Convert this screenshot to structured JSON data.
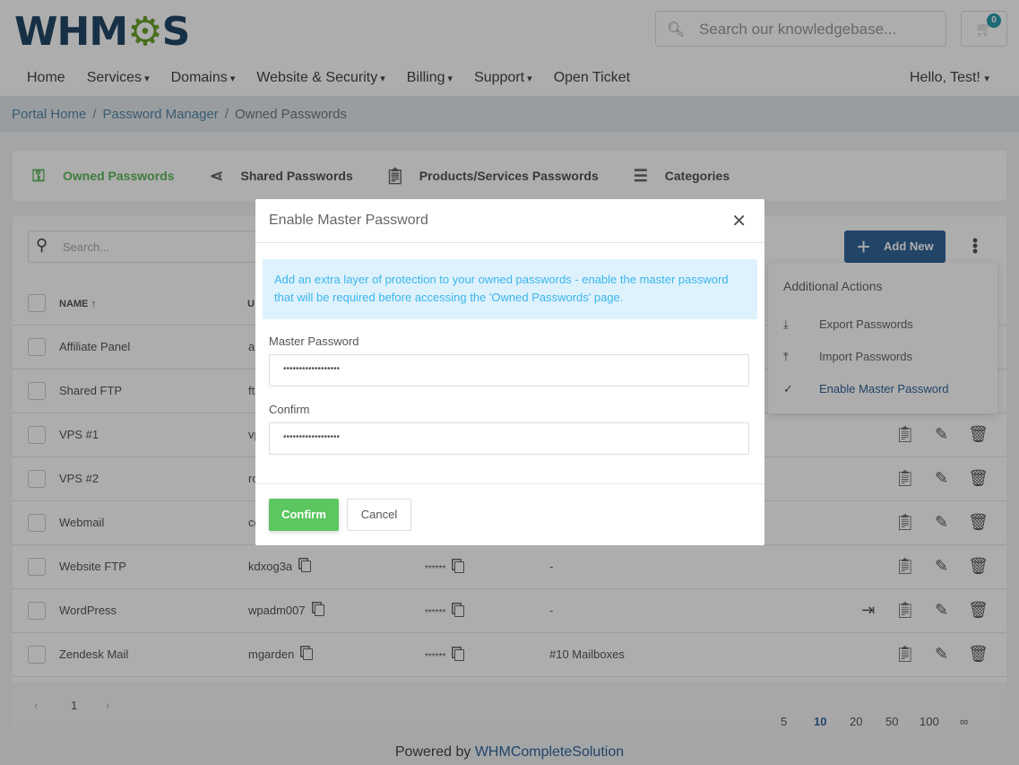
{
  "header": {
    "logo": "WHMCS",
    "search_placeholder": "Search our knowledgebase...",
    "cart_count": "0",
    "nav": [
      {
        "label": "Home",
        "dropdown": false
      },
      {
        "label": "Services",
        "dropdown": true
      },
      {
        "label": "Domains",
        "dropdown": true
      },
      {
        "label": "Website & Security",
        "dropdown": true
      },
      {
        "label": "Billing",
        "dropdown": true
      },
      {
        "label": "Support",
        "dropdown": true
      },
      {
        "label": "Open Ticket",
        "dropdown": false
      }
    ],
    "user_menu": "Hello, Test!"
  },
  "breadcrumb": [
    "Portal Home",
    "Password Manager",
    "Owned Passwords"
  ],
  "tabs": [
    {
      "label": "Owned Passwords",
      "icon": "key-icon",
      "active": true
    },
    {
      "label": "Shared Passwords",
      "icon": "share-icon"
    },
    {
      "label": "Products/Services Passwords",
      "icon": "clipboard-icon"
    },
    {
      "label": "Categories",
      "icon": "list-icon"
    }
  ],
  "table": {
    "search_placeholder": "Search...",
    "add_new": "Add New",
    "headers": {
      "name": "NAME ↑",
      "username": "U"
    },
    "rows": [
      {
        "name": "Affiliate Panel",
        "username": "a",
        "password": "",
        "note": "",
        "login": false
      },
      {
        "name": "Shared FTP",
        "username": "ft",
        "password": "",
        "note": "",
        "login": false
      },
      {
        "name": "VPS #1",
        "username": "vp",
        "password": "",
        "note": "",
        "login": false
      },
      {
        "name": "VPS #2",
        "username": "ro",
        "password": "",
        "note": "",
        "login": false
      },
      {
        "name": "Webmail",
        "username": "co",
        "password": "",
        "note": "",
        "login": false
      },
      {
        "name": "Website FTP",
        "username": "kdxog3a",
        "password": "******",
        "note": "-",
        "login": false
      },
      {
        "name": "WordPress",
        "username": "wpadm007",
        "password": "******",
        "note": "-",
        "login": true
      },
      {
        "name": "Zendesk Mail",
        "username": "mgarden",
        "password": "******",
        "note": "#10 Mailboxes",
        "login": false
      }
    ],
    "pagination": {
      "current": "1",
      "page_sizes": [
        "5",
        "10",
        "20",
        "50",
        "100",
        "∞"
      ],
      "selected_size": "10"
    }
  },
  "dropdown": {
    "title": "Additional Actions",
    "items": [
      {
        "label": "Export Passwords",
        "icon": "download-icon"
      },
      {
        "label": "Import Passwords",
        "icon": "upload-icon"
      },
      {
        "label": "Enable Master Password",
        "icon": "check-icon"
      }
    ]
  },
  "footer": {
    "prefix": "Powered by",
    "link": "WHMCompleteSolution"
  },
  "modal": {
    "title": "Enable Master Password",
    "info": "Add an extra layer of protection to your owned passwords - enable the master password that will be required before accessing the 'Owned Passwords' page.",
    "master_label": "Master Password",
    "master_value": "••••••••••••••••••",
    "confirm_label": "Confirm",
    "confirm_value": "••••••••••••••••••",
    "confirm_button": "Confirm",
    "cancel_button": "Cancel"
  },
  "colors": {
    "accent": "#336699",
    "success": "#5cb85c",
    "info_bg": "#def2fd",
    "info_text": "#3bb5ec"
  }
}
